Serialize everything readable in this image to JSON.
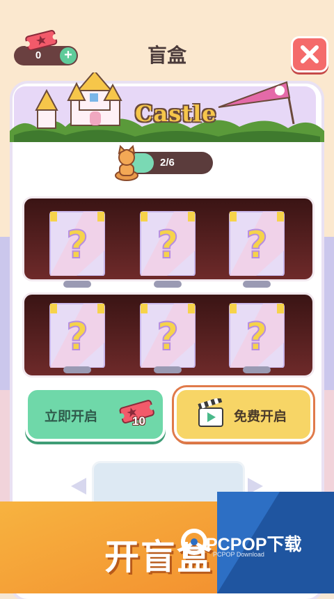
{
  "header": {
    "currency_value": "0",
    "plus_label": "+",
    "title": "盲盒"
  },
  "banner": {
    "theme_name": "Castle"
  },
  "progress": {
    "text": "2/6",
    "fraction": 0.33
  },
  "actions": {
    "open_now_label": "立即开启",
    "ticket_cost": "10",
    "free_open_label": "免费开启"
  },
  "promo": {
    "title": "开盲盒"
  },
  "watermark": {
    "brand": "PCPOP下载",
    "sub": "PCPOP Download"
  },
  "colors": {
    "accent_green": "#6fd8a9",
    "accent_yellow": "#f7d566",
    "close_red": "#f46b6b",
    "shelf_dark": "#4a1a1a"
  }
}
